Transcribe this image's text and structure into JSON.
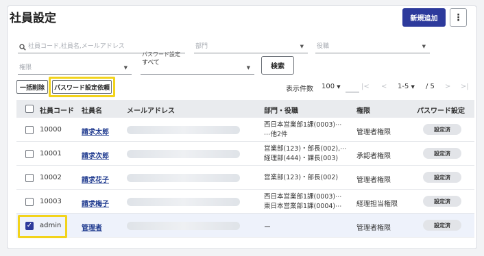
{
  "header": {
    "title": "社員設定",
    "new_button": "新規追加",
    "more_button": "⋮"
  },
  "filters": {
    "search_placeholder": "社員コード,社員名,メールアドレス",
    "dept_placeholder": "部門",
    "role_placeholder": "役職",
    "rank_placeholder": "権限",
    "pw_label": "パスワード設定",
    "pw_value": "すべて",
    "search_button": "検索"
  },
  "toolbar": {
    "bulk_delete": "一括削除",
    "pw_request": "パスワード設定依頼",
    "per_page_label": "表示件数",
    "per_page_value": "100",
    "range": "1-5",
    "total": "/ 5"
  },
  "table": {
    "headers": {
      "code": "社員コード",
      "name": "社員名",
      "email": "メールアドレス",
      "dept": "部門・役職",
      "rank": "権限",
      "pw": "パスワード設定"
    },
    "rows": [
      {
        "code": "10000",
        "name": "請求太郎",
        "dept1": "西日本営業部1課(0003)⋯",
        "dept2": "⋯他2件",
        "rank": "管理者権限",
        "pw": "設定済",
        "checked": false
      },
      {
        "code": "10001",
        "name": "請求次郎",
        "dept1": "営業部(123)・部長(002),⋯",
        "dept2": "経理部(444)・課長(003)",
        "rank": "承認者権限",
        "pw": "設定済",
        "checked": false
      },
      {
        "code": "10002",
        "name": "請求花子",
        "dept1": "営業部(123)・部長(002)",
        "dept2": "",
        "rank": "管理者権限",
        "pw": "設定済",
        "checked": false
      },
      {
        "code": "10003",
        "name": "請求梅子",
        "dept1": "西日本営業部1課(0003)⋯",
        "dept2": "東日本営業部1課(0004)⋯",
        "rank": "経理担当権限",
        "pw": "設定済",
        "checked": false
      },
      {
        "code": "admin",
        "name": "管理者",
        "dept1": "ー",
        "dept2": "",
        "rank": "管理者権限",
        "pw": "設定済",
        "checked": true
      }
    ]
  },
  "colors": {
    "accent": "#2d3a9c",
    "highlight": "#f2d31b"
  }
}
